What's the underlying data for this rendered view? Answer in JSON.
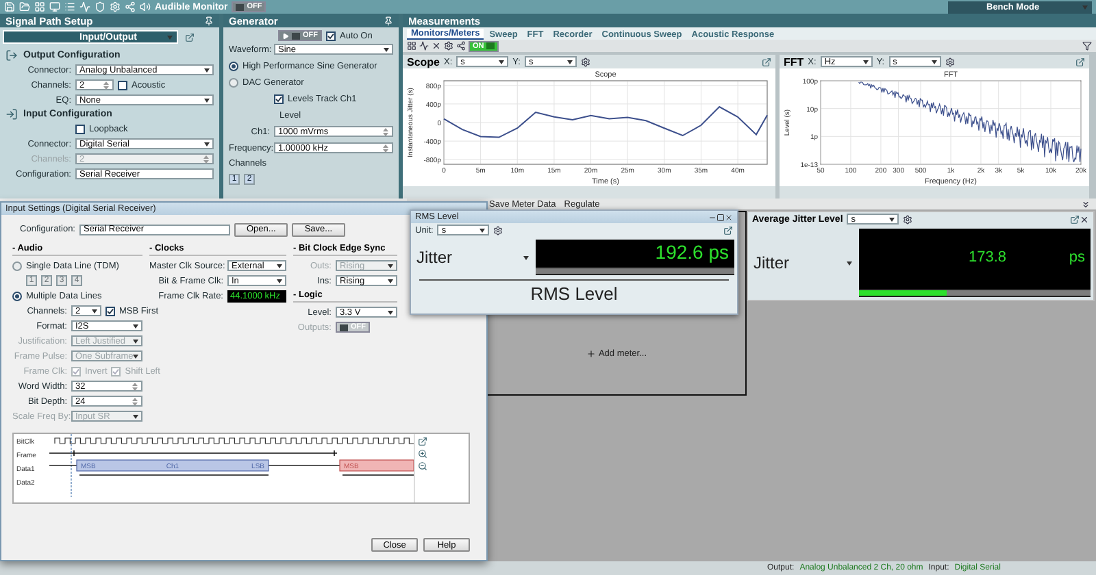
{
  "toolbar": {
    "monitor_label": "Audible Monitor",
    "monitor": {
      "label": "OFF",
      "on": false
    },
    "mode": "Bench Mode"
  },
  "signal_path": {
    "title": "Signal Path Setup",
    "view": "Input/Output",
    "sections": [
      {
        "title": "Output Configuration",
        "items": [
          {
            "kind": "select",
            "label": "Connector:",
            "value": "Analog Unbalanced",
            "disabled": false
          },
          {
            "kind": "spin",
            "label": "Channels:",
            "value": "2",
            "disabled": false,
            "option": {
              "label": "Acoustic",
              "checked": false
            }
          },
          {
            "kind": "select",
            "label": "EQ:",
            "value": "None",
            "disabled": false
          }
        ]
      },
      {
        "title": "Input Configuration",
        "items": [
          {
            "kind": "check",
            "label": "Loopback",
            "checked": false
          },
          {
            "kind": "select",
            "label": "Connector:",
            "value": "Digital Serial",
            "disabled": false
          },
          {
            "kind": "spin",
            "label": "Channels:",
            "value": "2",
            "disabled": true
          },
          {
            "kind": "text",
            "label": "Configuration:",
            "value": "Serial Receiver"
          }
        ]
      }
    ]
  },
  "generator": {
    "title": "Generator",
    "power": {
      "label": "OFF",
      "on": false
    },
    "auto_on": {
      "label": "Auto On",
      "checked": true
    },
    "items": [
      {
        "kind": "select",
        "label": "Waveform:",
        "value": "Sine",
        "disabled": false
      },
      {
        "kind": "radio",
        "label": "High Performance Sine Generator",
        "selected": true
      },
      {
        "kind": "radio",
        "label": "DAC Generator",
        "selected": false
      }
    ],
    "track": {
      "label": "Levels Track Ch1",
      "checked": true
    },
    "level_title": "Level",
    "level": {
      "kind": "spin",
      "label": "Ch1:",
      "value": "1000 mVrms",
      "disabled": false
    },
    "frequency": {
      "kind": "spin",
      "label": "Frequency:",
      "value": "1.00000 kHz",
      "disabled": false
    },
    "channels_title": "Channels",
    "channel_buttons": [
      "1",
      "2"
    ]
  },
  "measurements": {
    "title": "Measurements",
    "tabs": [
      {
        "label": "Monitors/Meters",
        "selected": true
      },
      {
        "label": "Sweep",
        "selected": false
      },
      {
        "label": "FFT",
        "selected": false
      },
      {
        "label": "Recorder",
        "selected": false
      },
      {
        "label": "Continuous Sweep",
        "selected": false
      },
      {
        "label": "Acoustic Response",
        "selected": false
      }
    ],
    "run": {
      "label": "ON",
      "on": true
    },
    "graphs": [
      {
        "title": "Scope",
        "x_label": "X:",
        "x_unit": "s",
        "y_label": "Y:",
        "y_unit": "s",
        "chart_data": {
          "type": "line",
          "grid": true,
          "title": "Scope",
          "xlabel": "Time (s)",
          "ylabel": "Instantaneous Jitter (s)",
          "x": [
            0,
            2.5,
            5,
            7.5,
            10,
            12.5,
            15,
            17.5,
            20,
            22.5,
            25,
            27.5,
            30,
            32.5,
            35,
            37.5,
            40,
            42.5,
            44
          ],
          "series": [
            {
              "color": "#3c4f8c",
              "values": [
                80,
                -150,
                -300,
                -320,
                -120,
                220,
                120,
                60,
                150,
                80,
                110,
                40,
                -120,
                -280,
                -60,
                340,
                120,
                -260,
                160
              ]
            }
          ],
          "xlim": [
            0,
            44
          ],
          "ylim": [
            -900,
            900
          ],
          "xticks": [
            {
              "value": 0,
              "label": "0"
            },
            {
              "value": 5,
              "label": "5m"
            },
            {
              "value": 10,
              "label": "10m"
            },
            {
              "value": 15,
              "label": "15m"
            },
            {
              "value": 20,
              "label": "20m"
            },
            {
              "value": 25,
              "label": "25m"
            },
            {
              "value": 30,
              "label": "30m"
            },
            {
              "value": 35,
              "label": "35m"
            },
            {
              "value": 40,
              "label": "40m"
            }
          ],
          "yticks": [
            {
              "value": 800,
              "label": "800p"
            },
            {
              "value": 400,
              "label": "400p"
            },
            {
              "value": 0,
              "label": "0"
            },
            {
              "value": -400,
              "label": "-400p"
            },
            {
              "value": -800,
              "label": "-800p"
            }
          ]
        }
      },
      {
        "title": "FFT",
        "x_label": "X:",
        "x_unit": "Hz",
        "y_label": "Y:",
        "y_unit": "s",
        "plot": {
          "title": "FFT",
          "xlabel": "Frequency (Hz)",
          "ylabel": "Level (s)",
          "xtick_labels": [
            "50",
            "100",
            "200",
            "300",
            "500",
            "1k",
            "2k",
            "3k",
            "5k",
            "10k",
            "20k"
          ],
          "ytick_labels": [
            "100p",
            "10p",
            "1p",
            "1e-13"
          ]
        }
      }
    ],
    "meter_toolbar": [
      "Save Meter Data",
      "Regulate"
    ],
    "add_meter": "Add meter..."
  },
  "rms_window": {
    "title": "RMS Level",
    "unit_label": "Unit:",
    "unit": "s",
    "quantity": "Jitter",
    "reading": "192.6 ps",
    "caption": "RMS Level"
  },
  "average_meter": {
    "title": "Average Jitter Level",
    "unit": "s",
    "quantity": "Jitter",
    "value": "173.8",
    "unit_text": "ps",
    "level": 0.38
  },
  "dialog": {
    "title": "Input Settings (Digital Serial Receiver)",
    "configuration": {
      "label": "Configuration:",
      "value": "Serial Receiver"
    },
    "actions": [
      "Open...",
      "Save..."
    ],
    "columns": [
      {
        "groups": [
          {
            "title": "- Audio",
            "items": [
              {
                "kind": "radio",
                "label": "Single Data Line (TDM)",
                "selected": false
              },
              {
                "kind": "buttons",
                "buttons": [
                  "1",
                  "2",
                  "3",
                  "4"
                ],
                "disabled": true
              },
              {
                "kind": "radio",
                "label": "Multiple Data Lines",
                "selected": true
              },
              {
                "kind": "select",
                "label": "Channels:",
                "value": "2",
                "disabled": false,
                "option": {
                  "label": "MSB First",
                  "checked": true
                }
              },
              {
                "kind": "select",
                "label": "Format:",
                "value": "I2S",
                "disabled": false
              },
              {
                "kind": "select",
                "label": "Justification:",
                "value": "Left Justified",
                "disabled": true
              },
              {
                "kind": "select",
                "label": "Frame Pulse:",
                "value": "One Subframe",
                "disabled": true
              },
              {
                "kind": "checks",
                "label": "Frame Clk:",
                "disabled": true,
                "options": [
                  {
                    "label": "Invert",
                    "checked": true
                  },
                  {
                    "label": "Shift Left",
                    "checked": true
                  }
                ]
              },
              {
                "kind": "spin",
                "label": "Word Width:",
                "value": "32",
                "disabled": false
              },
              {
                "kind": "spin",
                "label": "Bit Depth:",
                "value": "24",
                "disabled": false
              },
              {
                "kind": "select",
                "label": "Scale Freq By:",
                "value": "Input SR",
                "disabled": true
              }
            ]
          }
        ]
      },
      {
        "groups": [
          {
            "title": "- Clocks",
            "items": [
              {
                "kind": "select",
                "label": "Master Clk Source:",
                "value": "External",
                "disabled": false
              },
              {
                "kind": "select",
                "label": "Bit & Frame Clk:",
                "value": "In",
                "disabled": false
              },
              {
                "kind": "readout",
                "label": "Frame Clk Rate:",
                "value": "44.1000 kHz"
              }
            ]
          }
        ]
      },
      {
        "groups": [
          {
            "title": "- Bit Clock Edge Sync",
            "items": [
              {
                "kind": "select",
                "label": "Outs:",
                "value": "Rising",
                "disabled": true
              },
              {
                "kind": "select",
                "label": "Ins:",
                "value": "Rising",
                "disabled": false
              }
            ]
          },
          {
            "title": "- Logic",
            "items": [
              {
                "kind": "select",
                "label": "Level:",
                "value": "3.3 V",
                "disabled": false
              },
              {
                "kind": "toggle",
                "label": "Outputs:",
                "value": "OFF",
                "on": false,
                "disabled": true
              }
            ]
          }
        ]
      }
    ],
    "timing": {
      "signals": [
        "BitClk",
        "Frame",
        "Data1",
        "Data2"
      ],
      "blocks": [
        {
          "kind": "current",
          "msb": "MSB",
          "name": "Ch1",
          "lsb": "LSB"
        },
        {
          "kind": "next",
          "msb": "MSB"
        }
      ]
    },
    "buttons": [
      "Close",
      "Help"
    ]
  },
  "status_bar": [
    {
      "label": "Output:",
      "value": "Analog Unbalanced 2 Ch, 20 ohm"
    },
    {
      "label": "Input:",
      "value": "Digital Serial"
    }
  ]
}
